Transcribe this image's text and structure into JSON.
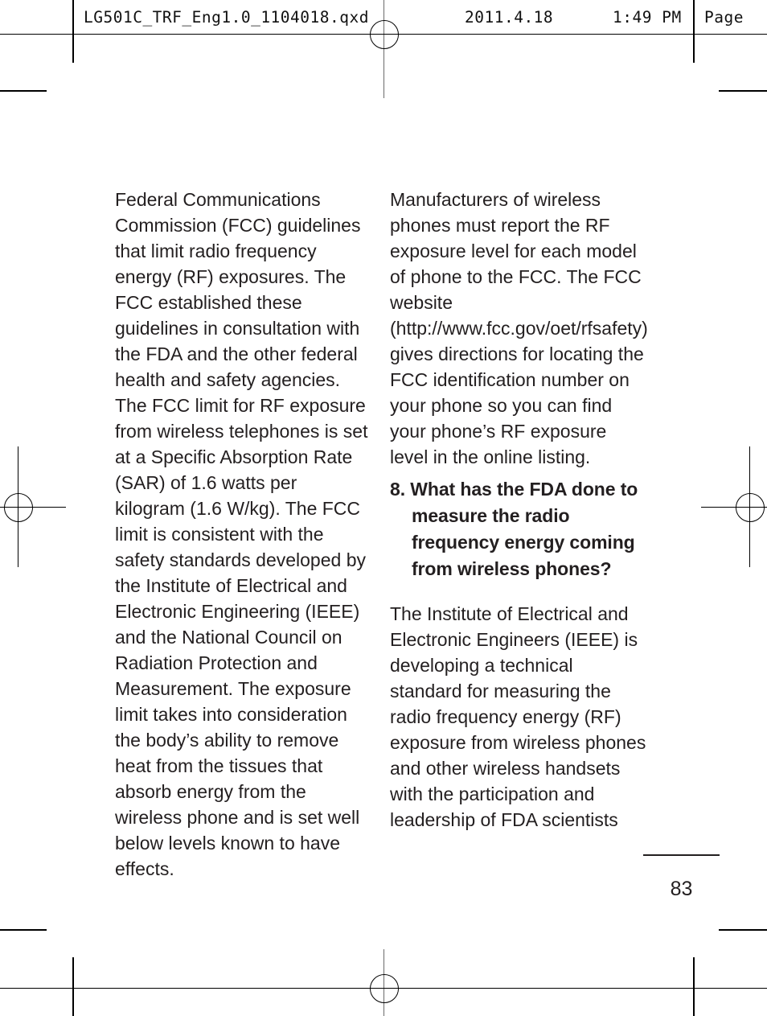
{
  "proof_header": {
    "filename": "LG501C_TRF_Eng1.0_1104018.qxd",
    "date": "2011.4.18",
    "time": "1:49 PM",
    "page_label": "Page"
  },
  "document": {
    "left_column": {
      "paragraphs": [
        "Federal Communications Commission (FCC) guidelines that limit radio frequency energy (RF) exposures. The FCC established these guidelines in consultation with the FDA and the other federal health and safety agencies. The FCC limit for RF exposure from wireless telephones is set at a Specific Absorption Rate (SAR) of 1.6 watts per kilogram (1.6 W/kg). The FCC limit is consistent with the safety standards developed by the Institute of Electrical and Electronic Engineering (IEEE) and the National Council on Radiation Protection and Measurement. The exposure limit takes into consideration the body’s ability to remove heat from the tissues that absorb energy from the wireless phone and is set well below levels known to have effects."
      ]
    },
    "right_column": {
      "intro_paragraph": "Manufacturers of wireless phones must report the RF exposure level for each model of phone to the FCC. The FCC website (http://www.fcc.gov/oet/rfsafety) gives directions for locating the FCC identification number on your phone so you can find your phone’s RF exposure level in the online listing.",
      "question": "8. What has the FDA done to measure the radio frequency energy coming from wireless phones?",
      "answer_paragraph": "The Institute of Electrical and Electronic Engineers (IEEE) is developing a technical standard for measuring the radio frequency energy (RF) exposure from wireless phones and other wireless handsets with the participation and leadership of FDA scientists"
    }
  },
  "footer": {
    "page_number": "83"
  },
  "colors": {
    "text": "#231f20",
    "marks": "#000000",
    "background": "#ffffff"
  }
}
